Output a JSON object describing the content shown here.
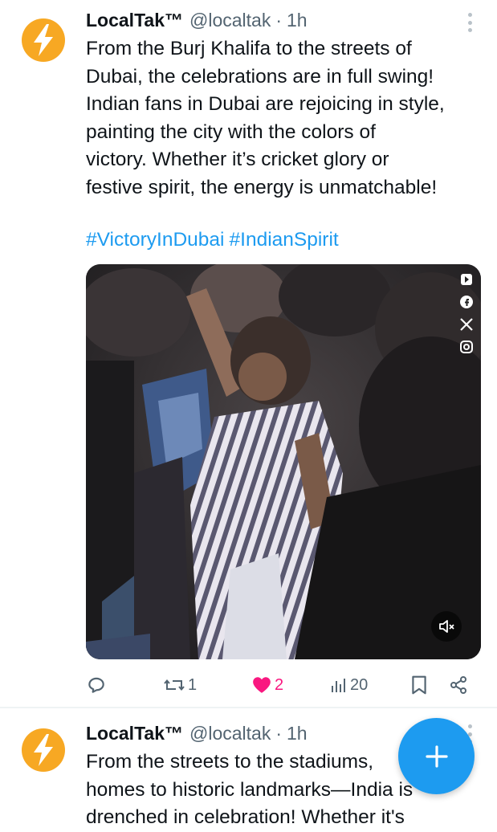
{
  "colors": {
    "brand_blue": "#1d9bf0",
    "like_pink": "#f91880",
    "avatar_orange": "#f7a823",
    "text_primary": "#0f1419",
    "text_secondary": "#536471"
  },
  "tweets": [
    {
      "author_name": "LocalTak™",
      "handle": "@localtak",
      "separator": "·",
      "time": "1h",
      "text": "From the Burj Khalifa to the streets of\nDubai, the celebrations are in full swing!\nIndian fans in Dubai are rejoicing in style,\npainting the city with the colors of\nvictory. Whether it’s cricket glory or\nfestive spirit, the energy is unmatchable!",
      "hashtags": [
        "#VictoryInDubai",
        "#IndianSpirit"
      ],
      "media": {
        "type": "video",
        "muted": true
      },
      "actions": {
        "reply_count": "",
        "retweet_count": "1",
        "like_count": "2",
        "liked": true,
        "views_count": "20"
      }
    },
    {
      "author_name": "LocalTak™",
      "handle": "@localtak",
      "separator": "·",
      "time": "1h",
      "text": "From the streets to the stadiums,\nhomes to historic landmarks—India is\ndrenched in celebration! Whether it's"
    }
  ],
  "fab": {
    "icon": "plus-icon"
  }
}
